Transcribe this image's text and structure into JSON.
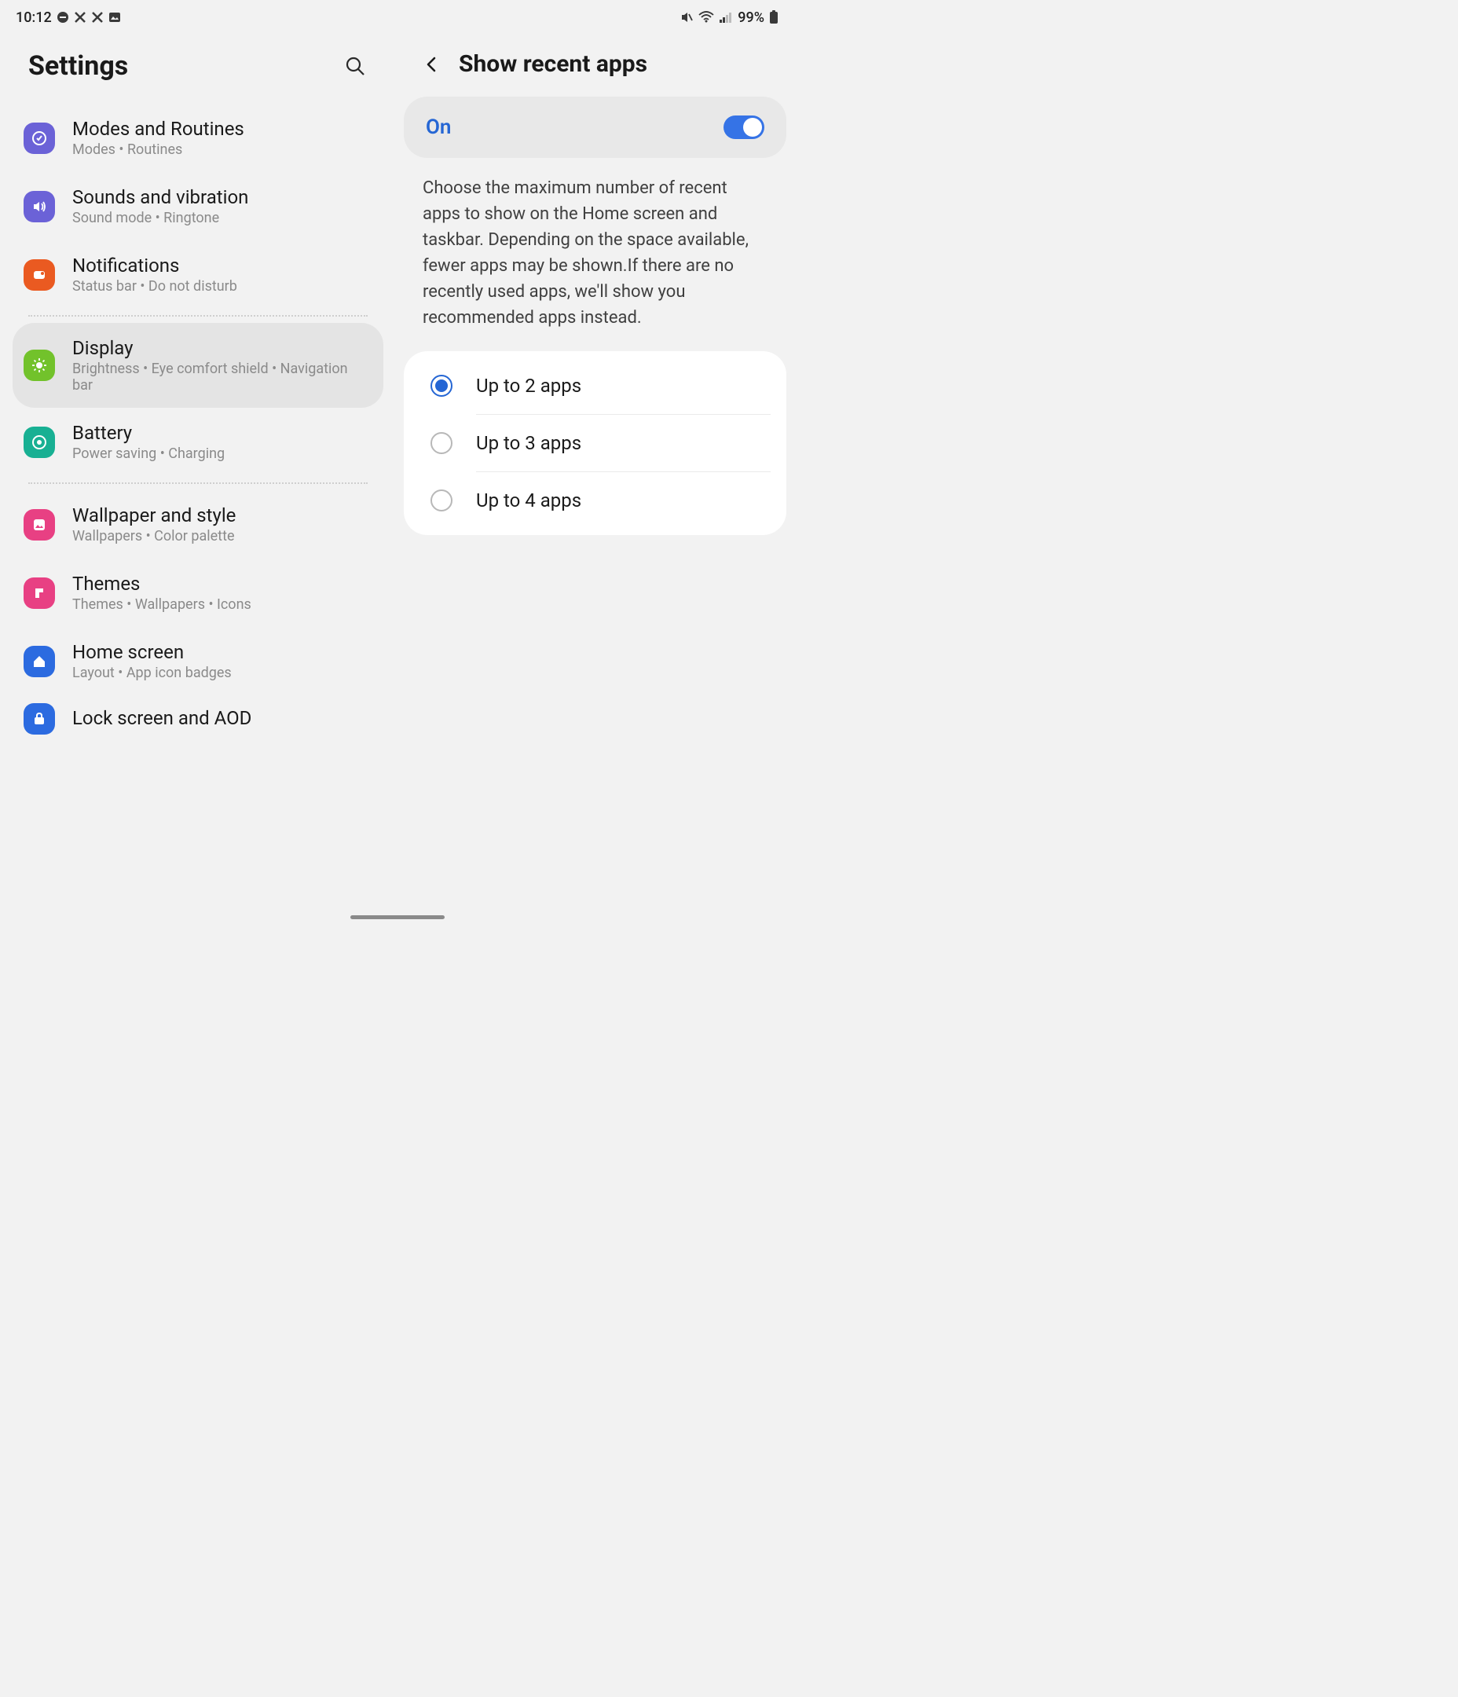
{
  "status": {
    "time": "10:12",
    "battery": "99%"
  },
  "left": {
    "title": "Settings",
    "items": [
      {
        "title": "Modes and Routines",
        "sub": "Modes  •  Routines",
        "color": "#6b62d7",
        "icon": "routines"
      },
      {
        "title": "Sounds and vibration",
        "sub": "Sound mode  •  Ringtone",
        "color": "#6b62d7",
        "icon": "sound"
      },
      {
        "title": "Notifications",
        "sub": "Status bar  •  Do not disturb",
        "color": "#ea5a21",
        "icon": "notif"
      },
      {
        "title": "Display",
        "sub": "Brightness  •  Eye comfort shield  •  Navigation bar",
        "color": "#72c22b",
        "icon": "display",
        "selected": true
      },
      {
        "title": "Battery",
        "sub": "Power saving  •  Charging",
        "color": "#18b093",
        "icon": "battery"
      },
      {
        "title": "Wallpaper and style",
        "sub": "Wallpapers  •  Color palette",
        "color": "#e84083",
        "icon": "wallpaper"
      },
      {
        "title": "Themes",
        "sub": "Themes  •  Wallpapers  •  Icons",
        "color": "#e84083",
        "icon": "themes"
      },
      {
        "title": "Home screen",
        "sub": "Layout  •  App icon badges",
        "color": "#2c6be0",
        "icon": "home"
      },
      {
        "title": "Lock screen and AOD",
        "sub": "",
        "color": "#2c6be0",
        "icon": "lock"
      }
    ]
  },
  "right": {
    "title": "Show recent apps",
    "toggle_label": "On",
    "description": "Choose the maximum number of recent apps to show on the Home screen and taskbar. Depending on the space available, fewer apps may be shown.If there are no recently used apps, we'll show you recommended apps instead.",
    "options": [
      {
        "label": "Up to 2 apps",
        "checked": true
      },
      {
        "label": "Up to 3 apps",
        "checked": false
      },
      {
        "label": "Up to 4 apps",
        "checked": false
      }
    ]
  }
}
